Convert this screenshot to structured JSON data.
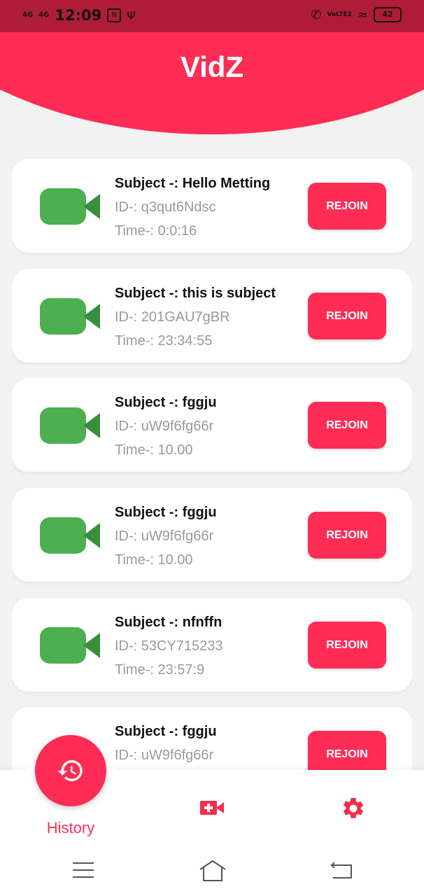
{
  "status_bar": {
    "signal1": "4G",
    "signal2": "4G",
    "time": "12:09",
    "notif_icon": "N",
    "network": "VoLTE2",
    "battery": "42"
  },
  "app": {
    "title": "VidZ"
  },
  "meetings": [
    {
      "subject": "Subject -: Hello Metting",
      "id": "ID-: q3qut6Ndsc",
      "time": "Time-: 0:0:16",
      "button": "REJOIN"
    },
    {
      "subject": "Subject -: this is subject",
      "id": "ID-: 201GAU7gBR",
      "time": "Time-: 23:34:55",
      "button": "REJOIN"
    },
    {
      "subject": "Subject -: fggju",
      "id": "ID-: uW9f6fg66r",
      "time": "Time-: 10.00",
      "button": "REJOIN"
    },
    {
      "subject": "Subject -: fggju",
      "id": "ID-: uW9f6fg66r",
      "time": "Time-: 10.00",
      "button": "REJOIN"
    },
    {
      "subject": "Subject -: nfnffn",
      "id": "ID-: 53CY715233",
      "time": "Time-: 23:57:9",
      "button": "REJOIN"
    },
    {
      "subject": "Subject -: fggju",
      "id": "ID-: uW9f6fg66r",
      "time": "",
      "button": "REJOIN"
    }
  ],
  "bottom_nav": {
    "history_label": "History",
    "history_icon": "history-icon",
    "new_meeting_icon": "video-plus-icon",
    "settings_icon": "gear-icon"
  },
  "colors": {
    "accent": "#ff2c55",
    "camera": "#4caf50",
    "camera_dark": "#388e3c",
    "status_bar": "#b01c38"
  }
}
